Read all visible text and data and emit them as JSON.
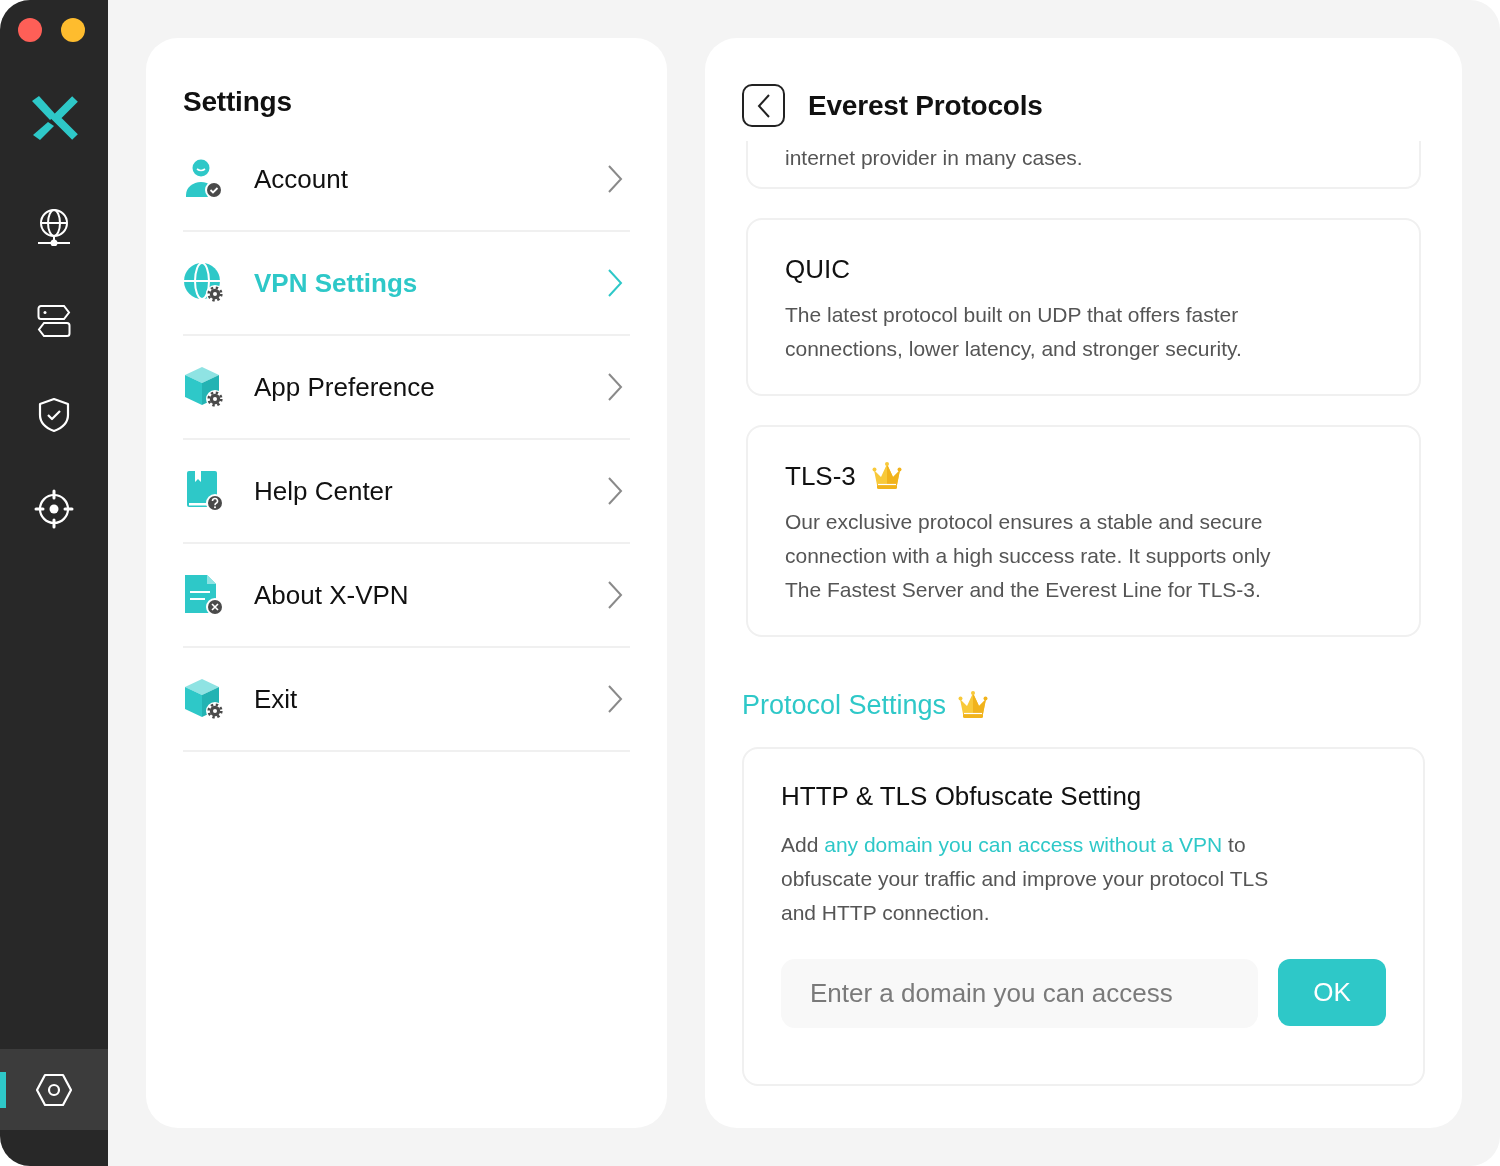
{
  "nav_rail": {
    "items": [
      {
        "selected": false
      },
      {
        "selected": false
      },
      {
        "selected": false
      },
      {
        "selected": false
      },
      {
        "selected": true
      }
    ]
  },
  "settings": {
    "title": "Settings",
    "items": [
      {
        "label": "Account",
        "selected": false
      },
      {
        "label": "VPN Settings",
        "selected": true
      },
      {
        "label": "App Preference",
        "selected": false
      },
      {
        "label": "Help Center",
        "selected": false
      },
      {
        "label": "About X-VPN",
        "selected": false
      },
      {
        "label": "Exit",
        "selected": false
      }
    ]
  },
  "detail": {
    "title": "Everest Protocols",
    "protocols": [
      {
        "description": "internet provider in many cases."
      },
      {
        "title": "QUIC",
        "premium": false,
        "description": "The latest protocol built on UDP that offers faster connections, lower latency, and stronger security."
      },
      {
        "title": "TLS-3",
        "premium": true,
        "description": "Our exclusive protocol ensures a stable and secure connection with a high success rate. It supports only The Fastest Server and the Everest Line for TLS-3."
      }
    ],
    "section": {
      "heading": "Protocol Settings",
      "premium": true,
      "card": {
        "title": "HTTP & TLS Obfuscate Setting",
        "description_start": "Add",
        "link": "any domain you can access without a VPN",
        "description_end": "to obfuscate your traffic and improve your protocol TLS and HTTP connection.",
        "input": {
          "placeholder": "Enter a domain you can access"
        },
        "button": "OK"
      }
    }
  }
}
